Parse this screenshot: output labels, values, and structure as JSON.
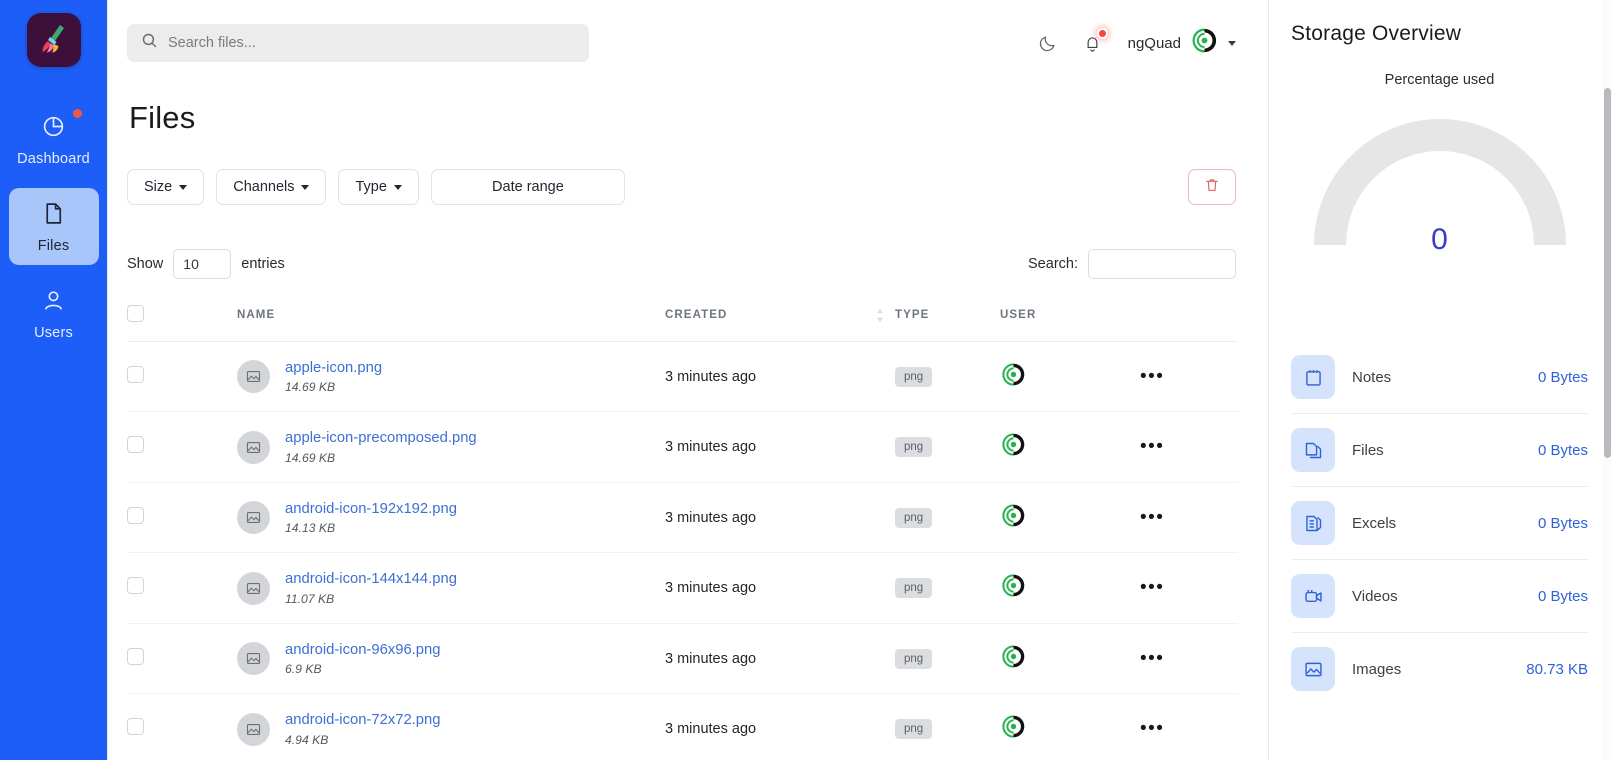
{
  "brand": {
    "logo_icon": "broom-icon",
    "logo_bg": "#3d0f3b"
  },
  "sidebar": {
    "bg_color": "#1c5ef7",
    "items": [
      {
        "label": "Dashboard",
        "icon": "pie-chart-icon",
        "active": false,
        "badge": true
      },
      {
        "label": "Files",
        "icon": "file-icon",
        "active": true,
        "badge": false
      },
      {
        "label": "Users",
        "icon": "user-icon",
        "active": false,
        "badge": false
      }
    ]
  },
  "topbar": {
    "search_placeholder": "Search files...",
    "search_value": "",
    "search_icon": "search-icon",
    "theme_toggle_icon": "moon-icon",
    "notifications_icon": "bell-icon",
    "notifications_has_alert": true,
    "user_name": "ngQuad",
    "avatar_icon": "gear-logo-avatar",
    "dropdown_icon": "chevron-down-icon"
  },
  "page": {
    "title": "Files",
    "filters": [
      {
        "label": "Size",
        "has_caret": true
      },
      {
        "label": "Channels",
        "has_caret": true
      },
      {
        "label": "Type",
        "has_caret": true
      },
      {
        "label": "Date range",
        "has_caret": false
      }
    ],
    "delete_button_icon": "trash-icon",
    "delete_button_color": "#e2645f"
  },
  "table_controls": {
    "show_label": "Show",
    "entries_value": "10",
    "entries_label": "entries",
    "search_label": "Search:",
    "search_value": ""
  },
  "table": {
    "columns": [
      "NAME",
      "CREATED",
      "TYPE",
      "USER"
    ],
    "sort_icon": "sort-icon",
    "rows": [
      {
        "name": "apple-icon.png",
        "size": "14.69 KB",
        "created": "3 minutes ago",
        "type": "png",
        "user_icon": "gear-logo-avatar",
        "actions_icon": "ellipsis-icon",
        "checked": false
      },
      {
        "name": "apple-icon-precomposed.png",
        "size": "14.69 KB",
        "created": "3 minutes ago",
        "type": "png",
        "user_icon": "gear-logo-avatar",
        "actions_icon": "ellipsis-icon",
        "checked": false
      },
      {
        "name": "android-icon-192x192.png",
        "size": "14.13 KB",
        "created": "3 minutes ago",
        "type": "png",
        "user_icon": "gear-logo-avatar",
        "actions_icon": "ellipsis-icon",
        "checked": false
      },
      {
        "name": "android-icon-144x144.png",
        "size": "11.07 KB",
        "created": "3 minutes ago",
        "type": "png",
        "user_icon": "gear-logo-avatar",
        "actions_icon": "ellipsis-icon",
        "checked": false
      },
      {
        "name": "android-icon-96x96.png",
        "size": "6.9 KB",
        "created": "3 minutes ago",
        "type": "png",
        "user_icon": "gear-logo-avatar",
        "actions_icon": "ellipsis-icon",
        "checked": false
      },
      {
        "name": "android-icon-72x72.png",
        "size": "4.94 KB",
        "created": "3 minutes ago",
        "type": "png",
        "user_icon": "gear-logo-avatar",
        "actions_icon": "ellipsis-icon",
        "checked": false
      }
    ]
  },
  "storage": {
    "title": "Storage Overview",
    "gauge_label": "Percentage used",
    "gauge_value": "0",
    "gauge_percent": 0,
    "gauge_track_color": "#e6e6e6",
    "gauge_value_color": "#3a39c9",
    "items": [
      {
        "label": "Notes",
        "value": "0 Bytes",
        "icon": "notebook-icon"
      },
      {
        "label": "Files",
        "value": "0 Bytes",
        "icon": "copy-files-icon"
      },
      {
        "label": "Excels",
        "value": "0 Bytes",
        "icon": "spreadsheet-icon"
      },
      {
        "label": "Videos",
        "value": "0 Bytes",
        "icon": "video-camera-icon"
      },
      {
        "label": "Images",
        "value": "80.73 KB",
        "icon": "image-icon"
      }
    ]
  }
}
